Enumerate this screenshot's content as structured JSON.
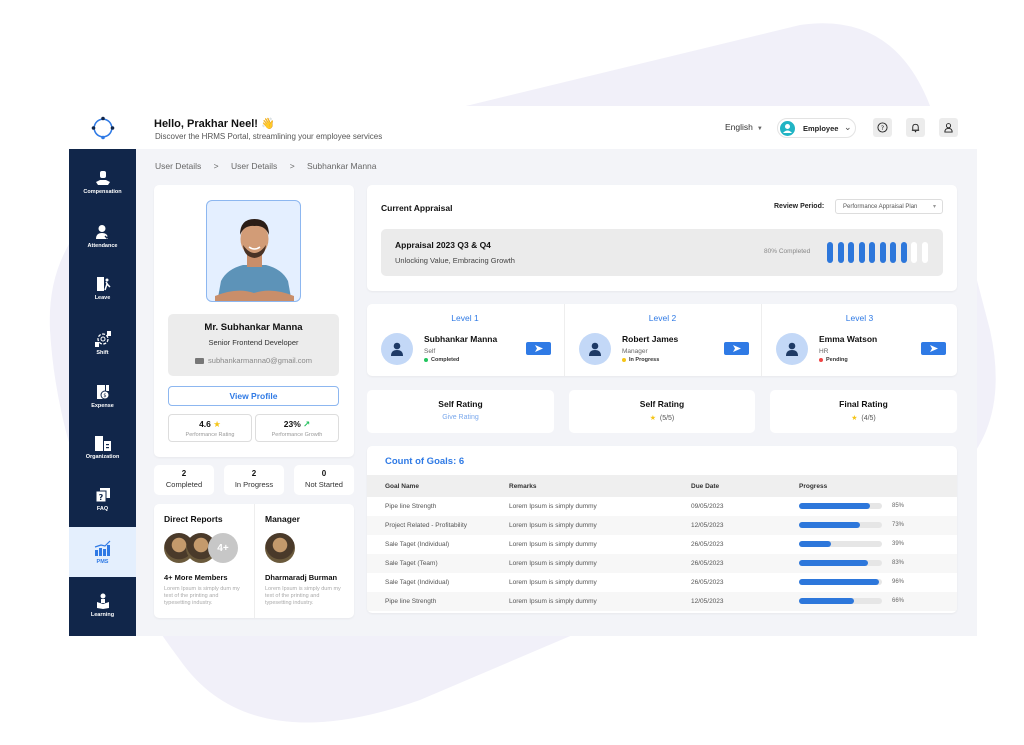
{
  "header": {
    "greeting": "Hello, Prakhar Neel! 👋",
    "subtitle": "Discover the HRMS Portal, streamlining your employee services",
    "language": "English",
    "role": "Employee",
    "icons": [
      "help-icon",
      "bell-icon",
      "user-icon"
    ]
  },
  "sidebar": {
    "items": [
      {
        "label": "Compensation",
        "icon": "money-hand-icon",
        "active": false
      },
      {
        "label": "Attendance",
        "icon": "user-check-icon",
        "active": false
      },
      {
        "label": "Leave",
        "icon": "door-exit-icon",
        "active": false
      },
      {
        "label": "Shift",
        "icon": "shift-cycle-icon",
        "active": false
      },
      {
        "label": "Expense",
        "icon": "expense-calc-icon",
        "active": false
      },
      {
        "label": "Organization",
        "icon": "building-icon",
        "active": false
      },
      {
        "label": "FAQ",
        "icon": "question-chat-icon",
        "active": false
      },
      {
        "label": "PMS",
        "icon": "growth-chart-icon",
        "active": true
      },
      {
        "label": "Learning",
        "icon": "reader-icon",
        "active": false
      }
    ]
  },
  "breadcrumb": [
    "User Details",
    ">",
    "User Details",
    ">",
    "Subhankar Manna"
  ],
  "profile": {
    "name": "Mr. Subhankar Manna",
    "role": "Senior Frontend Developer",
    "email": "subhankarmanna0@gmail.com",
    "view_profile": "View Profile",
    "rating_value": "4.6",
    "rating_label": "Performance Rating",
    "growth_value": "23%",
    "growth_label": "Performance Growth"
  },
  "counts": [
    {
      "value": "2",
      "label": "Completed"
    },
    {
      "value": "2",
      "label": "In Progress"
    },
    {
      "value": "0",
      "label": "Not Started"
    }
  ],
  "team": {
    "direct_reports": {
      "title": "Direct Reports",
      "more_badge": "4+",
      "name": "4+ More Members",
      "desc": "Lorem Ipsum is simply dum my text of the printing and typesetting industry."
    },
    "manager": {
      "title": "Manager",
      "name": "Dharmaradj Burman",
      "desc": "Lorem Ipsum is simply dum my text of the printing and typesetting industry."
    }
  },
  "appraisal": {
    "title": "Current Appraisal",
    "review_label": "Review Period:",
    "review_value": "Performance Appraisal Plan",
    "name": "Appraisal 2023 Q3 & Q4",
    "tagline": "Unlocking Value, Embracing Growth",
    "completed_text": "80% Completed",
    "segments_total": 10,
    "segments_done": 8
  },
  "levels": [
    {
      "title": "Level 1",
      "name": "Subhankar Manna",
      "role": "Self",
      "status": "Completed",
      "status_color": "#22c55e"
    },
    {
      "title": "Level 2",
      "name": "Robert James",
      "role": "Manager",
      "status": "In Progress",
      "status_color": "#f5c518"
    },
    {
      "title": "Level 3",
      "name": "Emma Watson",
      "role": "HR",
      "status": "Pending",
      "status_color": "#ef4444"
    }
  ],
  "ratings": [
    {
      "title": "Self Rating",
      "value": "Give Rating",
      "is_link": true
    },
    {
      "title": "Self Rating",
      "value": "(5/5)",
      "is_link": false
    },
    {
      "title": "Final Rating",
      "value": "(4/5)",
      "is_link": false
    }
  ],
  "goals": {
    "title": "Count of Goals: 6",
    "columns": [
      "Goal Name",
      "Remarks",
      "Due Date",
      "Progress"
    ],
    "rows": [
      {
        "name": "Pipe line Strength",
        "remarks": "Lorem Ipsum is simply dummy",
        "due": "09/05/2023",
        "progress": 85,
        "progress_text": "85%"
      },
      {
        "name": "Project Related - Profitability",
        "remarks": "Lorem Ipsum is simply dummy",
        "due": "12/05/2023",
        "progress": 73,
        "progress_text": "73%"
      },
      {
        "name": "Sale Taget (Individual)",
        "remarks": "Lorem Ipsum is simply dummy",
        "due": "26/05/2023",
        "progress": 39,
        "progress_text": "39%"
      },
      {
        "name": "Sale Taget (Team)",
        "remarks": "Lorem Ipsum is simply dummy",
        "due": "26/05/2023",
        "progress": 83,
        "progress_text": "83%"
      },
      {
        "name": "Sale Taget (Individual)",
        "remarks": "Lorem Ipsum is simply dummy",
        "due": "26/05/2023",
        "progress": 96,
        "progress_text": "96%"
      },
      {
        "name": "Pipe line Strength",
        "remarks": "Lorem Ipsum is simply dummy",
        "due": "12/05/2023",
        "progress": 66,
        "progress_text": "66%"
      }
    ]
  },
  "colors": {
    "sidebar_bg": "#11264a",
    "accent": "#2f7ae5",
    "progress": "#2d77db",
    "page_bg": "#f3f4f8"
  }
}
